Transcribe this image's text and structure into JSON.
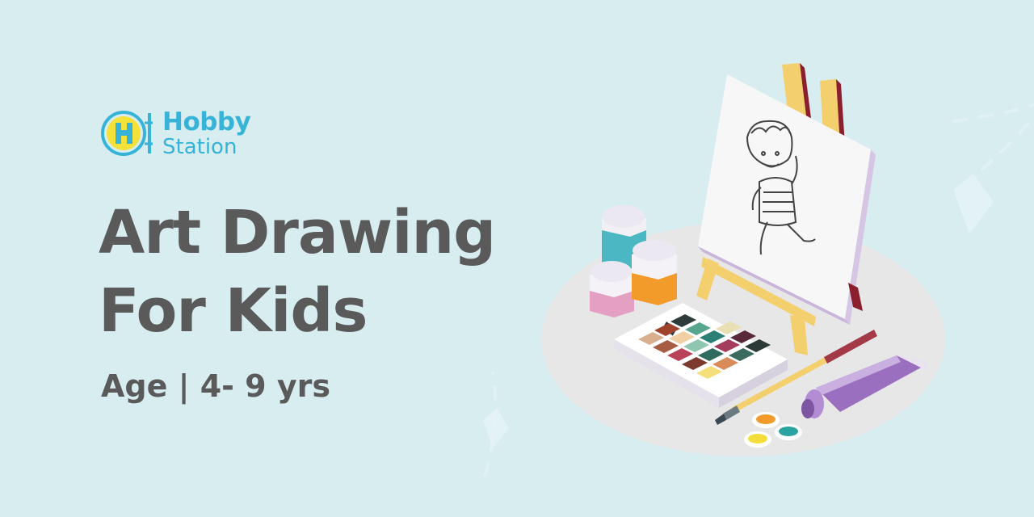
{
  "brand": {
    "name_line1": "Hobby",
    "name_line2": "Station",
    "mark_letter": "H"
  },
  "headline": {
    "line1": "Art Drawing",
    "line2": "For Kids"
  },
  "age_text": "Age | 4- 9 yrs",
  "colors": {
    "background": "#d8edf0",
    "brand": "#36b3d6",
    "logo_fill": "#f4e23a",
    "text": "#5a5a5a"
  }
}
